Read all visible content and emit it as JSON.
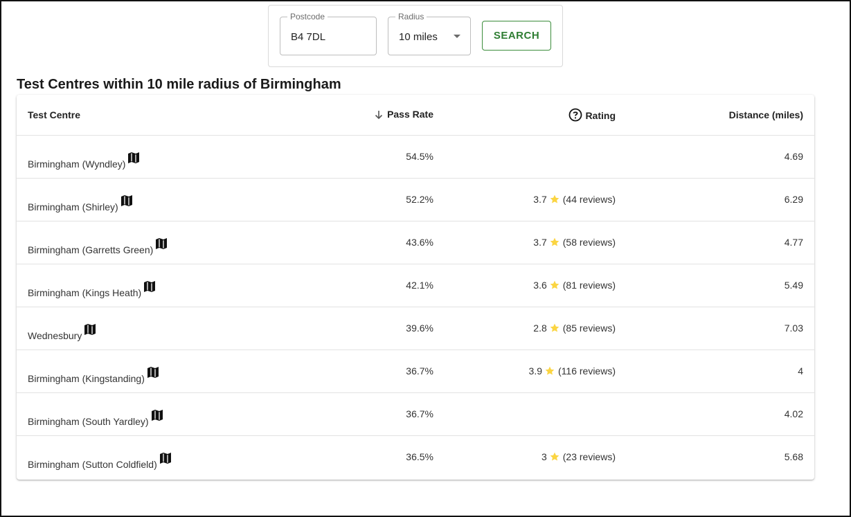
{
  "search": {
    "postcode_label": "Postcode",
    "postcode_value": "B4 7DL",
    "radius_label": "Radius",
    "radius_value": "10 miles",
    "button_label": "SEARCH"
  },
  "page_title": "Test Centres within 10 mile radius of Birmingham",
  "table": {
    "headers": {
      "centre": "Test Centre",
      "pass_rate": "Pass Rate",
      "rating": "Rating",
      "distance": "Distance (miles)"
    },
    "rows": [
      {
        "name": "Birmingham (Wyndley)",
        "pass_rate": "54.5%",
        "rating": "",
        "reviews": "",
        "distance": "4.69"
      },
      {
        "name": "Birmingham (Shirley)",
        "pass_rate": "52.2%",
        "rating": "3.7",
        "reviews": "(44 reviews)",
        "distance": "6.29"
      },
      {
        "name": "Birmingham (Garretts Green)",
        "pass_rate": "43.6%",
        "rating": "3.7",
        "reviews": "(58 reviews)",
        "distance": "4.77"
      },
      {
        "name": "Birmingham (Kings Heath)",
        "pass_rate": "42.1%",
        "rating": "3.6",
        "reviews": "(81 reviews)",
        "distance": "5.49"
      },
      {
        "name": "Wednesbury",
        "pass_rate": "39.6%",
        "rating": "2.8",
        "reviews": "(85 reviews)",
        "distance": "7.03"
      },
      {
        "name": "Birmingham (Kingstanding)",
        "pass_rate": "36.7%",
        "rating": "3.9",
        "reviews": "(116 reviews)",
        "distance": "4"
      },
      {
        "name": "Birmingham (South Yardley)",
        "pass_rate": "36.7%",
        "rating": "",
        "reviews": "",
        "distance": "4.02"
      },
      {
        "name": "Birmingham (Sutton Coldfield)",
        "pass_rate": "36.5%",
        "rating": "3",
        "reviews": "(23 reviews)",
        "distance": "5.68"
      }
    ]
  },
  "icons": {
    "map": "map-icon",
    "star": "star-icon",
    "sort": "arrow-down-icon",
    "help": "help-circle-icon"
  },
  "colors": {
    "accent_green": "#2e7d32",
    "star_yellow": "#fbd542"
  }
}
